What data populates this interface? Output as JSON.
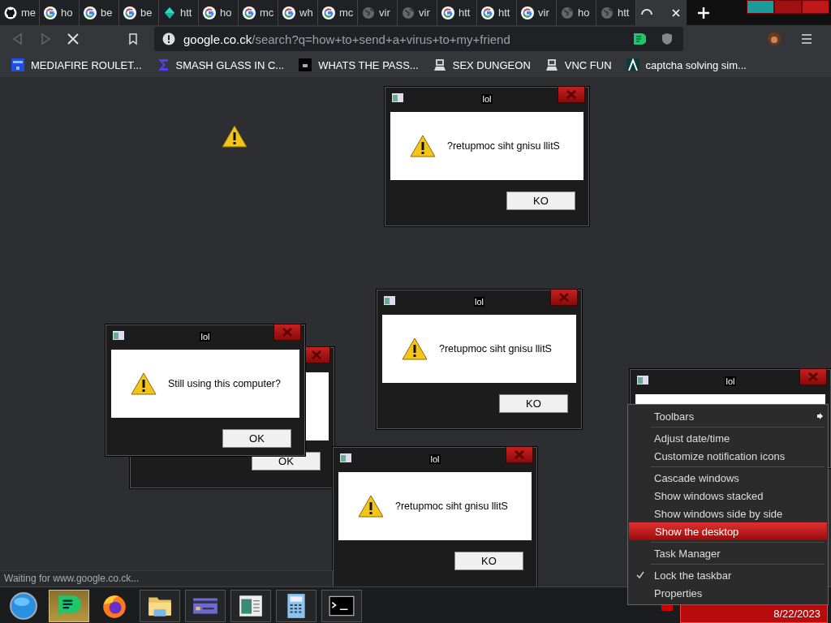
{
  "tabs": [
    {
      "title": "me",
      "kind": "github",
      "selected": false
    },
    {
      "title": "ho",
      "kind": "google",
      "selected": false
    },
    {
      "title": "be",
      "kind": "google",
      "selected": false
    },
    {
      "title": "be",
      "kind": "google",
      "selected": false
    },
    {
      "title": "htt",
      "kind": "diamond",
      "selected": false
    },
    {
      "title": "ho",
      "kind": "google",
      "selected": false
    },
    {
      "title": "mc",
      "kind": "google",
      "selected": false
    },
    {
      "title": "wh",
      "kind": "google",
      "selected": false
    },
    {
      "title": "mc",
      "kind": "google",
      "selected": false
    },
    {
      "title": "vir",
      "kind": "globe",
      "selected": false
    },
    {
      "title": "vir",
      "kind": "globe",
      "selected": false
    },
    {
      "title": "htt",
      "kind": "google",
      "selected": false
    },
    {
      "title": "htt",
      "kind": "google",
      "selected": false
    },
    {
      "title": "vir",
      "kind": "google",
      "selected": false
    },
    {
      "title": "ho",
      "kind": "globe",
      "selected": false
    },
    {
      "title": "htt",
      "kind": "globe",
      "selected": false
    },
    {
      "kind": "spinner",
      "selected": true
    }
  ],
  "toolbar": {
    "url_host": "google.co.ck",
    "url_path": "/search?q=how+to+send+a+virus+to+my+friend"
  },
  "bookmarks": [
    {
      "label": "MEDIAFIRE ROULET...",
      "kind": "tile"
    },
    {
      "label": "SMASH GLASS IN C...",
      "kind": "sigma"
    },
    {
      "label": "WHATS THE PASS...",
      "kind": "dark"
    },
    {
      "label": "SEX DUNGEON",
      "kind": "computer"
    },
    {
      "label": "VNC FUN",
      "kind": "computer"
    },
    {
      "label": "captcha solving sim...",
      "kind": "caret"
    }
  ],
  "dialogs": [
    {
      "title": "lol",
      "message": "?retupmoc siht gnisu llitS",
      "button": "KO"
    },
    {
      "title": "lol",
      "message": "?retupmoc siht gnisu llitS",
      "button": "KO"
    },
    {
      "button": "OK"
    },
    {
      "title": "lol",
      "message": "Still using this computer?",
      "button": "OK"
    },
    {
      "title": "lol",
      "message": "?retupmoc siht gnisu llitS",
      "button": "KO"
    },
    {
      "title": "lol"
    }
  ],
  "context_menu": [
    {
      "kind": "submenu",
      "label": "Toolbars",
      "selected": false
    },
    {
      "kind": "separator"
    },
    {
      "kind": "item",
      "label": "Adjust date/time",
      "selected": false
    },
    {
      "kind": "item",
      "label": "Customize notification icons",
      "selected": false
    },
    {
      "kind": "separator"
    },
    {
      "kind": "item",
      "label": "Cascade windows",
      "selected": false
    },
    {
      "kind": "item",
      "label": "Show windows stacked",
      "selected": false
    },
    {
      "kind": "item",
      "label": "Show windows side by side",
      "selected": false
    },
    {
      "kind": "item",
      "label": "Show the desktop",
      "selected": true
    },
    {
      "kind": "separator"
    },
    {
      "kind": "item",
      "label": "Task Manager",
      "selected": false
    },
    {
      "kind": "separator"
    },
    {
      "kind": "check",
      "label": "Lock the taskbar",
      "checked": true,
      "selected": false
    },
    {
      "kind": "item",
      "label": "Properties",
      "selected": false
    }
  ],
  "status_text": "Waiting for www.google.co.ck...",
  "taskbar": {
    "apps": [
      {
        "kind": "orb",
        "selected": false
      },
      {
        "kind": "chat",
        "selected": true
      },
      {
        "kind": "firefox",
        "selected": false
      },
      {
        "kind": "folder",
        "selected": false
      },
      {
        "kind": "card",
        "selected": false
      },
      {
        "kind": "window",
        "selected": false
      },
      {
        "kind": "calculator",
        "selected": false
      },
      {
        "kind": "terminal",
        "selected": false
      }
    ],
    "date": "8/22/2023"
  }
}
